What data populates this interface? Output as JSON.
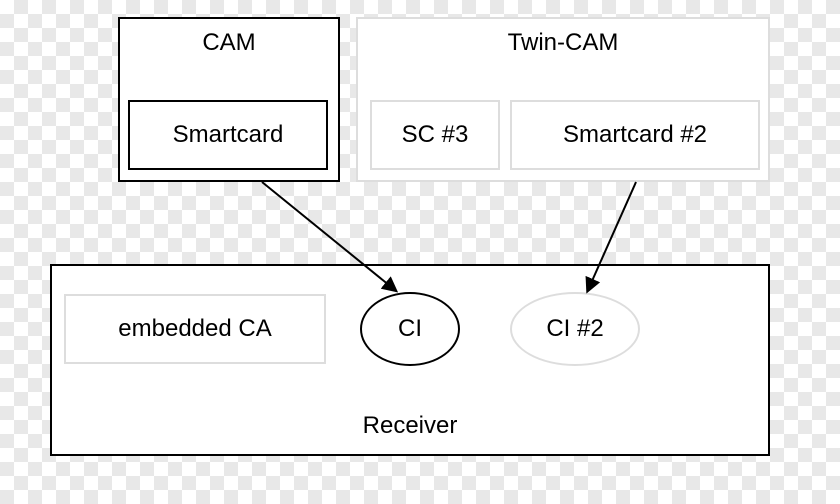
{
  "cam": {
    "title": "CAM",
    "smartcard": "Smartcard"
  },
  "twincam": {
    "title": "Twin-CAM",
    "sc3": "SC #3",
    "sc2": "Smartcard #2"
  },
  "receiver": {
    "title": "Receiver",
    "embedded": "embedded CA",
    "ci1": "CI",
    "ci2": "CI #2"
  }
}
